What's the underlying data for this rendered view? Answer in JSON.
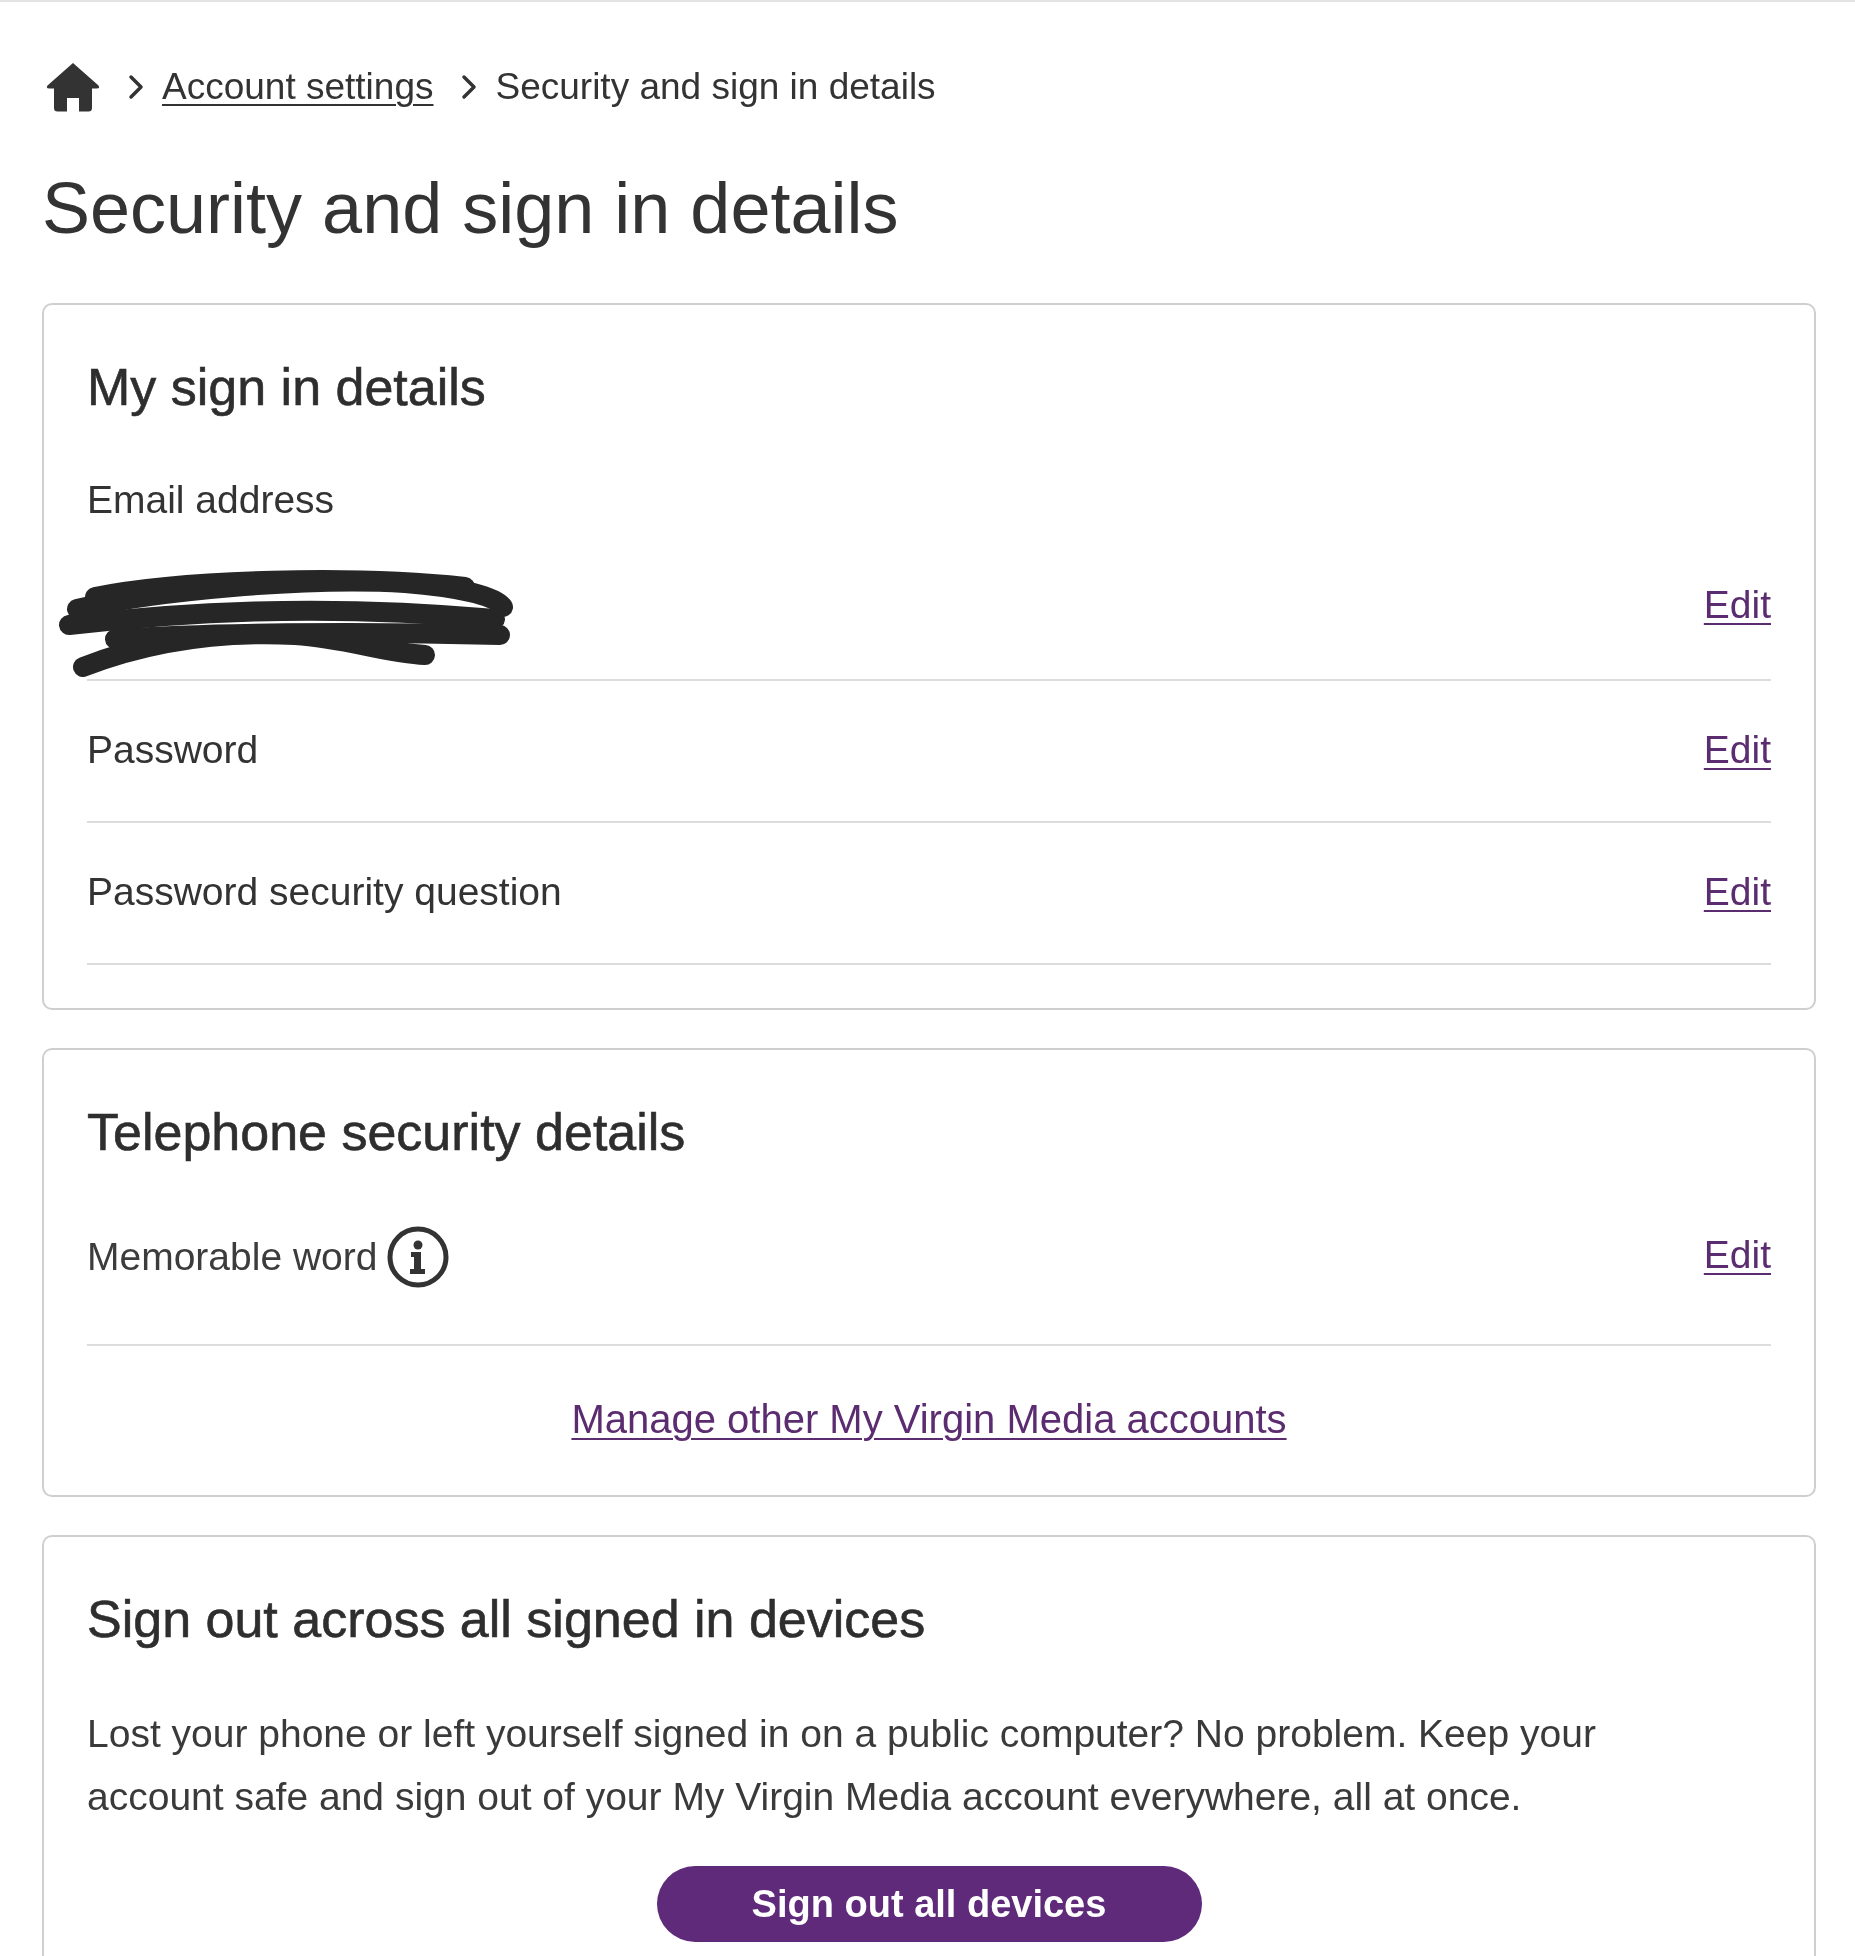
{
  "breadcrumb": [
    {
      "kind": "home"
    },
    {
      "kind": "link",
      "label": "Account settings"
    },
    {
      "kind": "current",
      "label": "Security and sign in details"
    }
  ],
  "page_title": "Security and sign in details",
  "cards": [
    {
      "title": "My sign in details",
      "rows": [
        {
          "kind": "stacked",
          "label": "Email address",
          "redacted": true,
          "info": false,
          "action": "Edit"
        },
        {
          "kind": "inline",
          "label": "Password",
          "info": false,
          "action": "Edit"
        },
        {
          "kind": "inline",
          "label": "Password security question",
          "info": false,
          "action": "Edit"
        }
      ]
    },
    {
      "title": "Telephone security details",
      "rows": [
        {
          "kind": "inline",
          "label": "Memorable word",
          "info": true,
          "action": "Edit"
        }
      ],
      "link": "Manage other My Virgin Media accounts"
    },
    {
      "title": "Sign out across all signed in devices",
      "text": "Lost your phone or left yourself signed in on a public computer? No problem. Keep your account safe and sign out of your My Virgin Media account everywhere, all at once.",
      "button": "Sign out all devices"
    }
  ]
}
